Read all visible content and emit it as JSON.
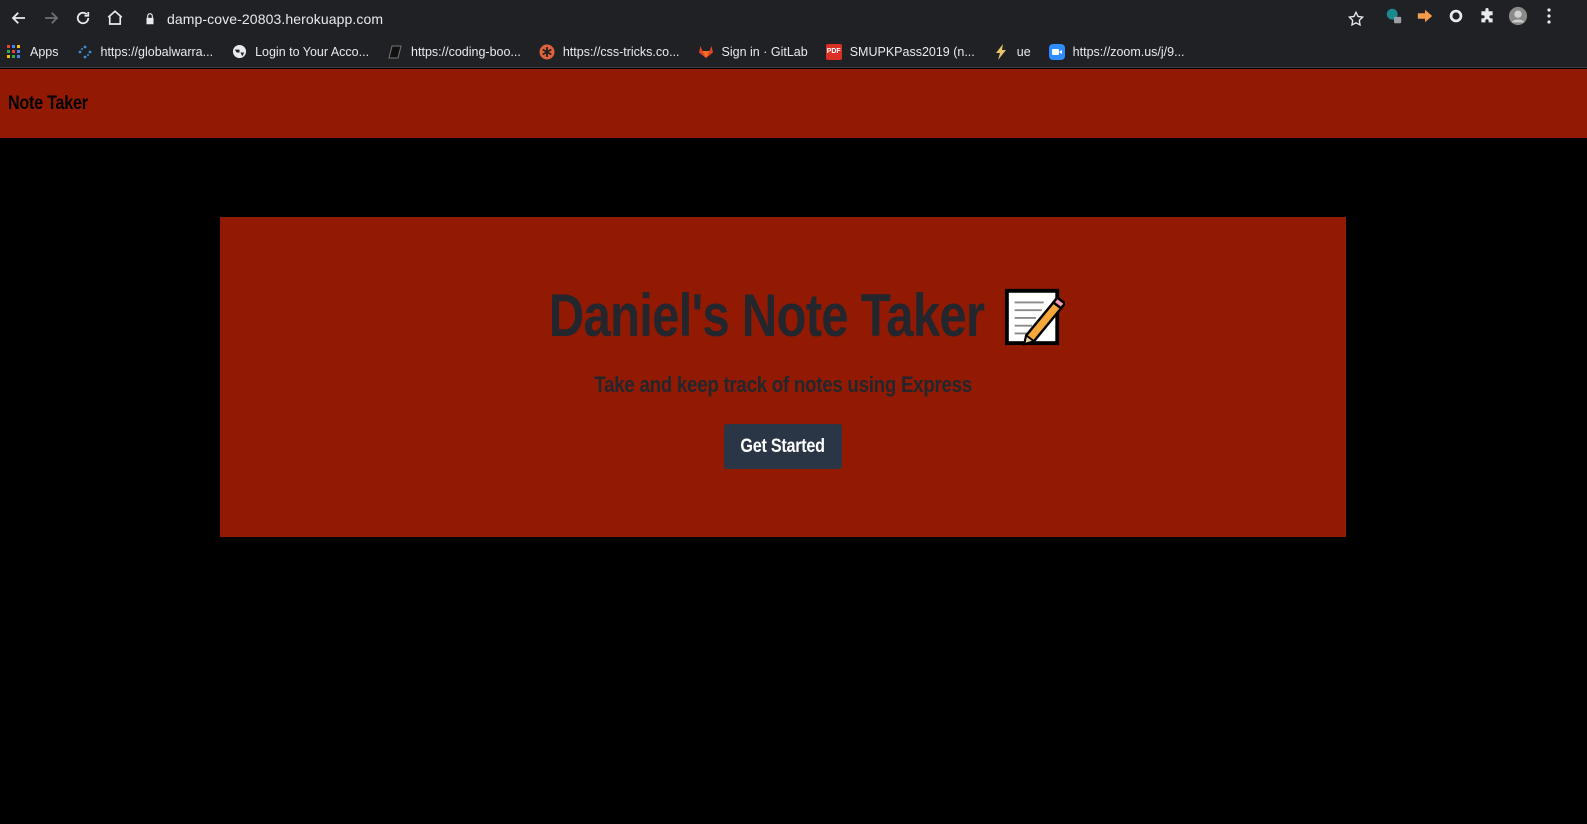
{
  "browser": {
    "url": "damp-cove-20803.herokuapp.com",
    "bookmarks": [
      {
        "label": "Apps",
        "icon": "apps-grid-icon"
      },
      {
        "label": "https://globalwarra...",
        "icon": "dots-icon"
      },
      {
        "label": "Login to Your Acco...",
        "icon": "globe-icon"
      },
      {
        "label": "https://coding-boo...",
        "icon": "book-icon"
      },
      {
        "label": "https://css-tricks.co...",
        "icon": "asterisk-icon"
      },
      {
        "label": "Sign in · GitLab",
        "icon": "gitlab-icon"
      },
      {
        "label": "SMUPKPass2019 (n...",
        "icon": "pdf-icon"
      },
      {
        "label": "ue",
        "icon": "bolt-icon"
      },
      {
        "label": "https://zoom.us/j/9...",
        "icon": "zoom-icon"
      }
    ]
  },
  "navbar": {
    "brand": "Note Taker"
  },
  "hero": {
    "title": "Daniel's Note Taker",
    "subtitle": "Take and keep track of notes using Express",
    "button": "Get Started"
  },
  "colors": {
    "accent": "#921a03",
    "button": "#2a3645",
    "heading": "#23262c",
    "background": "#000000"
  }
}
